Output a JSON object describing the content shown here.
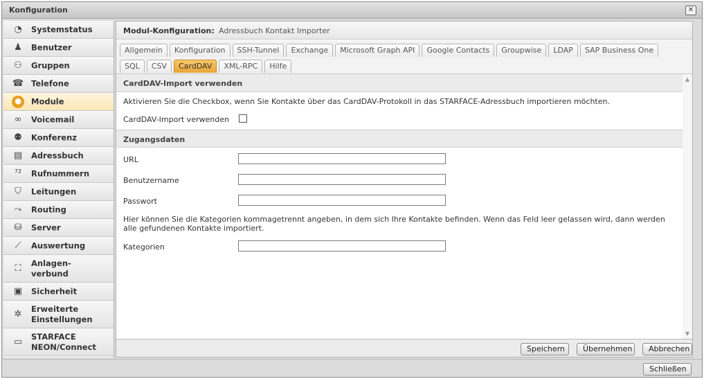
{
  "window": {
    "title": "Konfiguration",
    "close_label": "✕"
  },
  "sidebar": {
    "items": [
      {
        "name": "systemstatus",
        "label": "Systemstatus",
        "icon": "gauge-icon"
      },
      {
        "name": "benutzer",
        "label": "Benutzer",
        "icon": "user-icon"
      },
      {
        "name": "gruppen",
        "label": "Gruppen",
        "icon": "group-icon"
      },
      {
        "name": "telefone",
        "label": "Telefone",
        "icon": "phone-icon"
      },
      {
        "name": "module",
        "label": "Module",
        "icon": "module-icon",
        "active": true
      },
      {
        "name": "voicemail",
        "label": "Voicemail",
        "icon": "voicemail-icon"
      },
      {
        "name": "konferenz",
        "label": "Konferenz",
        "icon": "conference-icon"
      },
      {
        "name": "adressbuch",
        "label": "Adressbuch",
        "icon": "addressbook-icon"
      },
      {
        "name": "rufnummern",
        "label": "Rufnummern",
        "icon": "numbers-icon"
      },
      {
        "name": "leitungen",
        "label": "Leitungen",
        "icon": "lines-icon"
      },
      {
        "name": "routing",
        "label": "Routing",
        "icon": "routing-icon"
      },
      {
        "name": "server",
        "label": "Server",
        "icon": "server-icon"
      },
      {
        "name": "auswertung",
        "label": "Auswertung",
        "icon": "chart-icon"
      },
      {
        "name": "anlagenverbund",
        "label": "Anlagen-\nverbund",
        "icon": "network-icon"
      },
      {
        "name": "sicherheit",
        "label": "Sicherheit",
        "icon": "lock-icon"
      },
      {
        "name": "erweiterte",
        "label": "Erweiterte\nEinstellungen",
        "icon": "settings-icon"
      },
      {
        "name": "neon",
        "label": "STARFACE\nNEON/Connect",
        "icon": "video-icon"
      }
    ]
  },
  "module_header": {
    "key": "Modul-Konfiguration:",
    "value": "Adressbuch Kontakt Importer"
  },
  "tabs": {
    "row1": [
      "Allgemein",
      "Konfiguration",
      "SSH-Tunnel",
      "Exchange",
      "Microsoft Graph API",
      "Google Contacts",
      "Groupwise",
      "LDAP",
      "SAP Business One"
    ],
    "row2": [
      "SQL",
      "CSV",
      "CardDAV",
      "XML-RPC",
      "Hilfe"
    ],
    "active": "CardDAV"
  },
  "carddav": {
    "section_title": "CardDAV-Import verwenden",
    "description": "Aktivieren Sie die Checkbox, wenn Sie Kontakte über das CardDAV-Protokoll in das STARFACE-Adressbuch importieren möchten.",
    "checkbox_label": "CardDAV-Import verwenden",
    "checked": false
  },
  "access": {
    "section_title": "Zugangsdaten",
    "url_label": "URL",
    "url_value": "",
    "username_label": "Benutzername",
    "username_value": "",
    "password_label": "Passwort",
    "password_value": "",
    "categories_hint_line1": "Hier können Sie die Kategorien kommagetrennt angeben, in dem sich Ihre Kontakte befinden. Wenn das Feld leer gelassen wird, dann werden",
    "categories_hint_line2": "alle gefundenen Kontakte importiert.",
    "categories_label": "Kategorien",
    "categories_value": ""
  },
  "footer": {
    "save": "Speichern",
    "apply": "Übernehmen",
    "cancel": "Abbrechen"
  },
  "bottom": {
    "close": "Schließen"
  },
  "colors": {
    "accent": "#e9a534",
    "active_nav": "#fbe6b4"
  }
}
